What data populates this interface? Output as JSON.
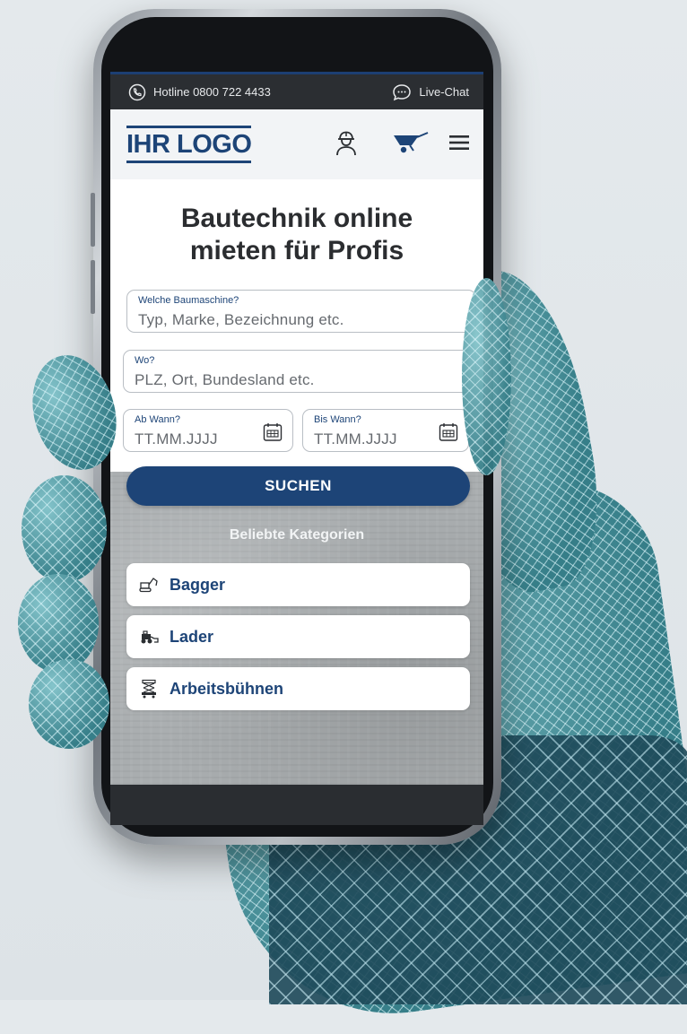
{
  "topbar": {
    "hotline_label": "Hotline 0800 722 4433",
    "chat_label": "Live-Chat"
  },
  "header": {
    "logo_text": "IHR LOGO",
    "icons": [
      "user-worker-icon",
      "wheelbarrow-cart-icon",
      "hamburger-menu-icon"
    ]
  },
  "hero": {
    "title_line1": "Bautechnik online",
    "title_line2": "mieten für Profis"
  },
  "search": {
    "machine": {
      "label": "Welche Baumaschine?",
      "placeholder": "Typ, Marke, Bezeichnung etc."
    },
    "location": {
      "label": "Wo?",
      "placeholder": "PLZ, Ort, Bundesland etc."
    },
    "from": {
      "label": "Ab Wann?",
      "placeholder": "TT.MM.JJJJ"
    },
    "to": {
      "label": "Bis Wann?",
      "placeholder": "TT.MM.JJJJ"
    },
    "button_label": "SUCHEN"
  },
  "categories": {
    "heading": "Beliebte Kategorien",
    "items": [
      {
        "label": "Bagger",
        "icon": "excavator-icon"
      },
      {
        "label": "Lader",
        "icon": "loader-icon"
      },
      {
        "label": "Arbeitsbühnen",
        "icon": "scissor-lift-icon"
      }
    ]
  },
  "colors": {
    "brand": "#1d4477",
    "topbar": "#2b2e32",
    "hand_mesh": "#3f8f98"
  }
}
